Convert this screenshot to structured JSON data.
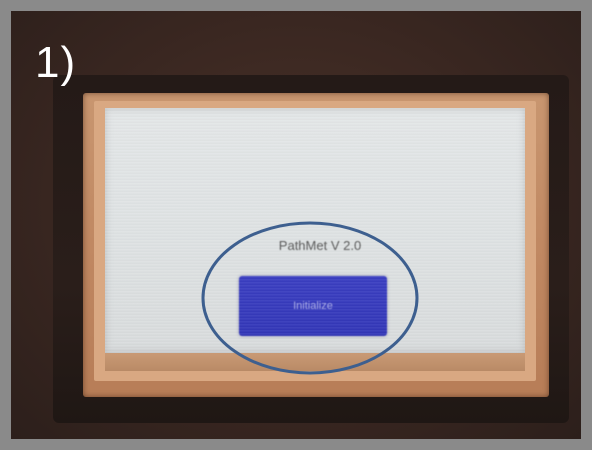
{
  "annotation": {
    "step_label": "1)"
  },
  "device_screen": {
    "version_text": "PathMet V 2.0",
    "initialize_button_label": "Initialize"
  },
  "colors": {
    "button_blue": "#3337b8",
    "highlight_ellipse": "#3d5f8f",
    "bezel_copper": "#c08862",
    "frame_gray": "#8a8a8a"
  }
}
